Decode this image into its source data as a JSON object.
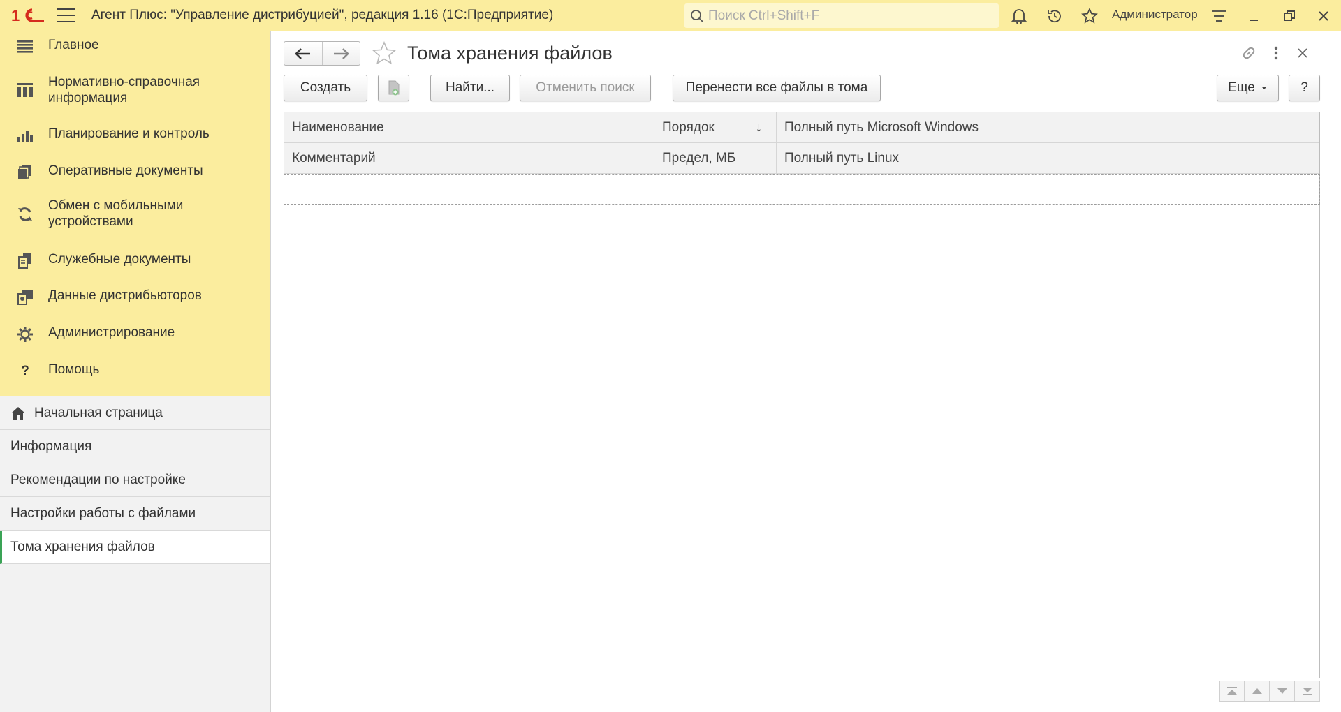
{
  "titlebar": {
    "app_title": "Агент Плюс: \"Управление дистрибуцией\", редакция 1.16  (1С:Предприятие)",
    "search_placeholder": "Поиск Ctrl+Shift+F",
    "user": "Администратор",
    "icons": [
      "1c-logo",
      "hamburger-icon",
      "search-icon",
      "bell-icon",
      "history-icon",
      "star-icon",
      "settings-lines-icon",
      "minimize-icon",
      "restore-icon",
      "close-icon"
    ]
  },
  "sidebar": {
    "sections": [
      {
        "label": "Главное",
        "icon": "list-icon"
      },
      {
        "label": "Нормативно-справочная информация",
        "icon": "catalog-icon"
      },
      {
        "label": "Планирование и контроль",
        "icon": "chart-icon"
      },
      {
        "label": "Оперативные документы",
        "icon": "documents-icon"
      },
      {
        "label": "Обмен с мобильными устройствами",
        "icon": "sync-icon"
      },
      {
        "label": "Служебные документы",
        "icon": "service-docs-icon"
      },
      {
        "label": "Данные дистрибьюторов",
        "icon": "distributors-icon"
      },
      {
        "label": "Администрирование",
        "icon": "gear-icon"
      },
      {
        "label": "Помощь",
        "icon": "help-icon"
      }
    ],
    "open_windows": [
      {
        "label": "Начальная страница",
        "icon": "home-icon"
      },
      {
        "label": "Информация"
      },
      {
        "label": "Рекомендации по настройке"
      },
      {
        "label": "Настройки работы с файлами"
      },
      {
        "label": "Тома хранения файлов",
        "active": true
      }
    ]
  },
  "form": {
    "title": "Тома хранения файлов",
    "toolbar": {
      "create": "Создать",
      "find": "Найти...",
      "cancel_search": "Отменить поиск",
      "move_files": "Перенести все файлы в тома",
      "more": "Еще",
      "help": "?"
    },
    "grid": {
      "header_row1": [
        "Наименование",
        "Порядок",
        "Полный путь Microsoft Windows"
      ],
      "header_row2": [
        "Комментарий",
        "Предел, МБ",
        "Полный путь Linux"
      ],
      "sort_indicator": "↓"
    }
  },
  "colors": {
    "panel_yellow": "#fbed9e",
    "active_marker": "#3aa356",
    "logo_red": "#d52b1e"
  }
}
